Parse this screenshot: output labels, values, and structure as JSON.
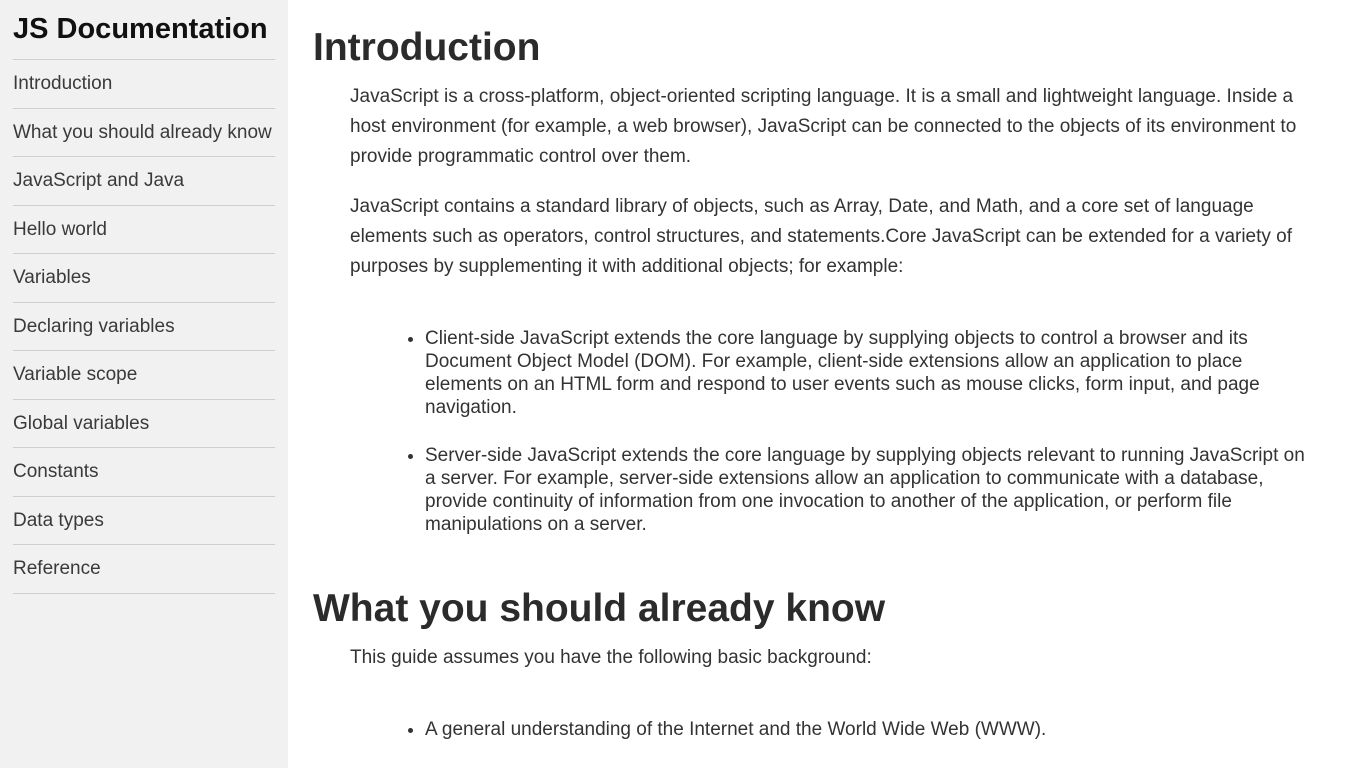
{
  "navbar": {
    "title": "JS Documentation",
    "items": [
      "Introduction",
      "What you should already know",
      "JavaScript and Java",
      "Hello world",
      "Variables",
      "Declaring variables",
      "Variable scope",
      "Global variables",
      "Constants",
      "Data types",
      "Reference"
    ]
  },
  "sections": {
    "introduction": {
      "title": "Introduction",
      "paragraphs": [
        "JavaScript is a cross-platform, object-oriented scripting language. It is a small and lightweight language. Inside a host environment (for example, a web browser), JavaScript can be connected to the objects of its environment to provide programmatic control over them.",
        "JavaScript contains a standard library of objects, such as Array, Date, and Math, and a core set of language elements such as operators, control structures, and statements.Core JavaScript can be extended for a variety of purposes by supplementing it with additional objects; for example:"
      ],
      "bullets": [
        "Client-side JavaScript extends the core language by supplying objects to control a browser and its Document Object Model (DOM). For example, client-side extensions allow an application to place elements on an HTML form and respond to user events such as mouse clicks, form input, and page navigation.",
        "Server-side JavaScript extends the core language by supplying objects relevant to running JavaScript on a server. For example, server-side extensions allow an application to communicate with a database, provide continuity of information from one invocation to another of the application, or perform file manipulations on a server."
      ]
    },
    "what_you_should_know": {
      "title": "What you should already know",
      "paragraphs": [
        "This guide assumes you have the following basic background:"
      ],
      "bullets": [
        "A general understanding of the Internet and the World Wide Web (WWW)."
      ]
    }
  }
}
